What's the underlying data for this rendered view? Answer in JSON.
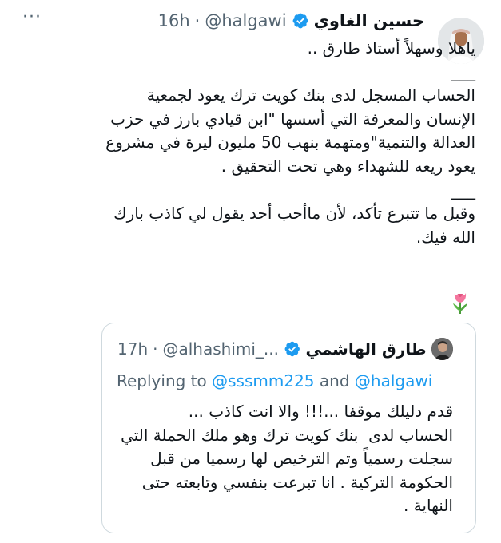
{
  "tweet": {
    "name": "حسين الغاوي",
    "handle": "@halgawi",
    "separator": "·",
    "time": "16h",
    "more": "···",
    "text": "ياهلا وسهلاً أستاذ طارق ..\n___\nالحساب المسجل لدى بنك كويت ترك يعود لجمعية الإنسان والمعرفة التي أسسها \"ابن قيادي بارز في حزب العدالة والتنمية\"ومتهمة بنهب 50 مليون ليرة في مشروع  يعود ريعه للشهداء وهي تحت التحقيق .\n___\nوقبل ما تتبرع تأكد، لأن ماأحب أحد يقول لي كاذب بارك الله فيك.",
    "emoji": "tulip-emoji"
  },
  "quote": {
    "name": "طارق الهاشمي",
    "handle": "@alhashimi_...",
    "separator": "·",
    "time": "17h",
    "replying_prefix": "Replying to",
    "mention_1": "@sssmm225",
    "and_word": "and",
    "mention_2": "@halgawi",
    "text": "قدم دليلك موقفا ...!!! والا انت كاذب ...\nالحساب لدى  بنك كويت ترك وهو ملك الحملة التي سجلت رسمياً وتم الترخيص لها رسميا من قبل الحكومة التركية . انا تبرعت بنفسي وتابعته حتى النهاية ."
  },
  "colors": {
    "text": "#0f1419",
    "muted": "#536471",
    "accent": "#1d9bf0",
    "border": "#cfd9de"
  },
  "icons": {
    "verified": "verified-badge-icon",
    "more": "more-options-icon"
  }
}
